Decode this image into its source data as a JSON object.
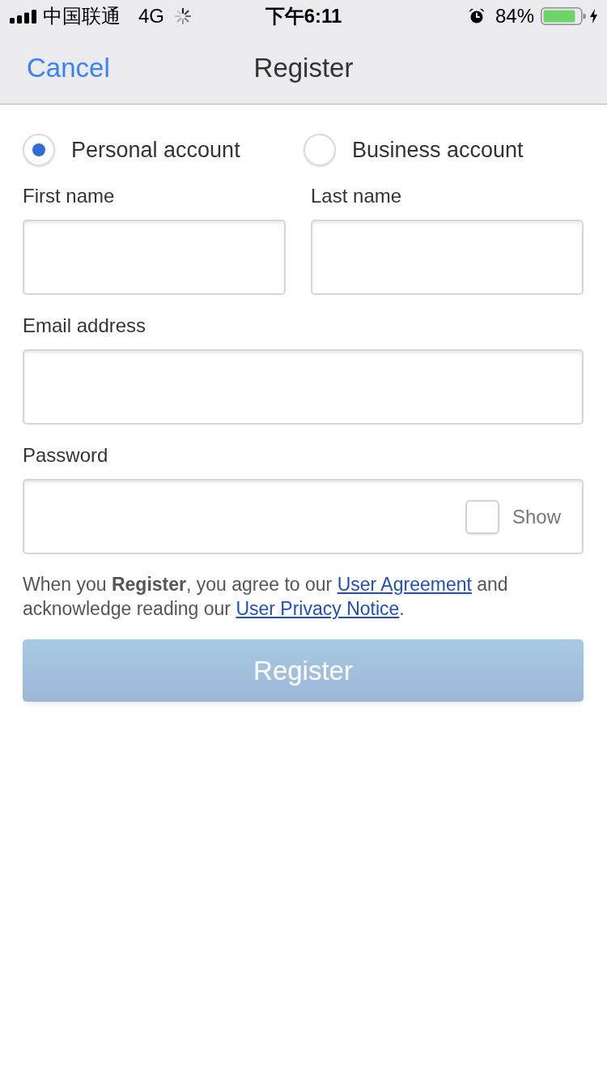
{
  "status_bar": {
    "carrier": "中国联通",
    "network": "4G",
    "time": "下午6:11",
    "battery": "84%"
  },
  "nav_bar": {
    "cancel": "Cancel",
    "title": "Register"
  },
  "account_types": [
    {
      "label": "Personal account",
      "selected": true
    },
    {
      "label": "Business account",
      "selected": false
    }
  ],
  "name_fields": [
    {
      "label": "First name"
    },
    {
      "label": "Last name"
    }
  ],
  "email_field": {
    "label": "Email address"
  },
  "password_field": {
    "label": "Password",
    "show": {
      "label": "Show",
      "checked": false
    }
  },
  "agreement": [
    {
      "kind": "text",
      "text": "When you **Register**, you agree to our "
    },
    {
      "kind": "link",
      "text": "User Agreement"
    },
    {
      "kind": "text",
      "text": " and acknowledge reading our "
    },
    {
      "kind": "link",
      "text": "User Privacy Notice"
    },
    {
      "kind": "text",
      "text": "."
    }
  ],
  "register_button": {
    "label": "Register",
    "disabled": true
  }
}
